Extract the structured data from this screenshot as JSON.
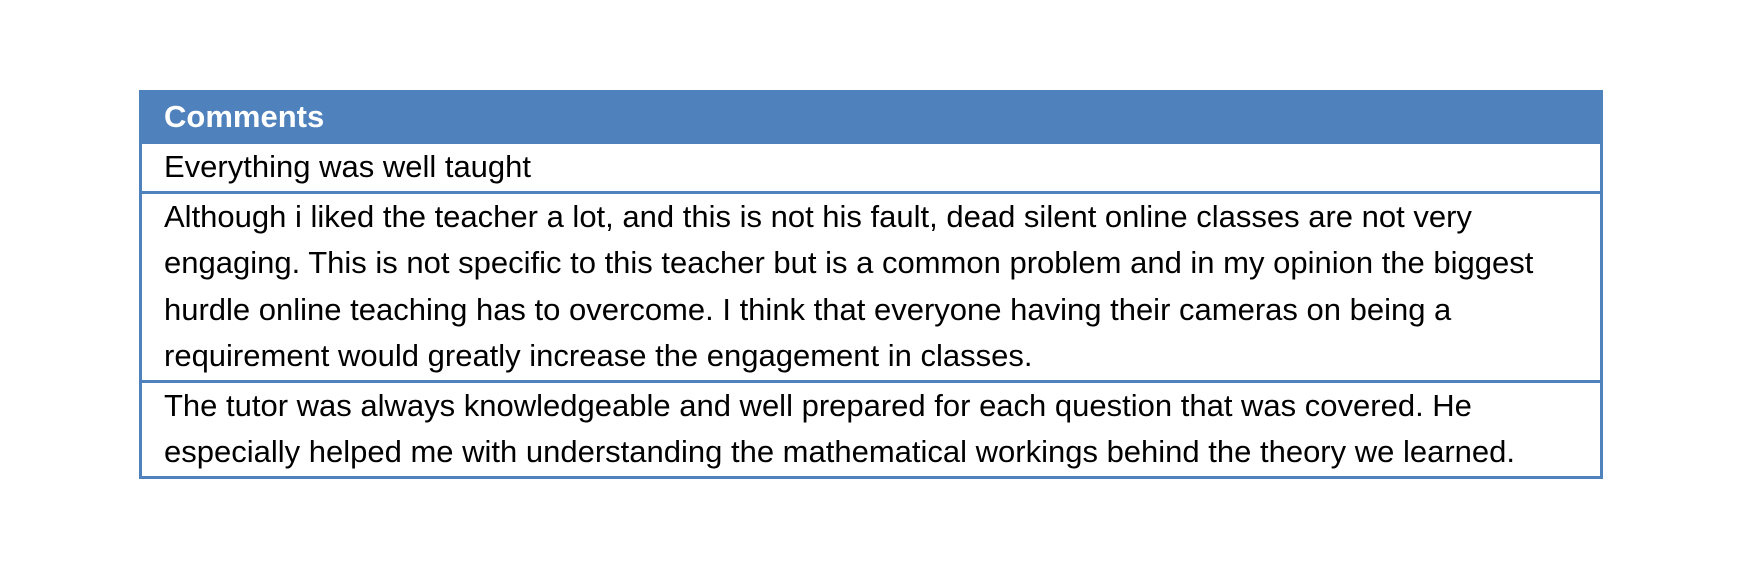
{
  "table": {
    "header": "Comments",
    "rows": [
      "Everything was well taught",
      "Although i liked the teacher a lot, and this is not his fault, dead silent online classes are not very engaging. This is not specific to this teacher but is a common problem and in my opinion the biggest hurdle online teaching has to overcome. I think that everyone having their cameras on being a requirement would greatly increase the engagement in classes.",
      "The tutor was always knowledgeable and well prepared for each question that was covered. He especially helped me with understanding the mathematical workings behind the theory we learned."
    ],
    "colors": {
      "header_background": "#4f81bd",
      "header_text": "#ffffff",
      "border": "#4f81bd",
      "body_text": "#000000"
    }
  }
}
